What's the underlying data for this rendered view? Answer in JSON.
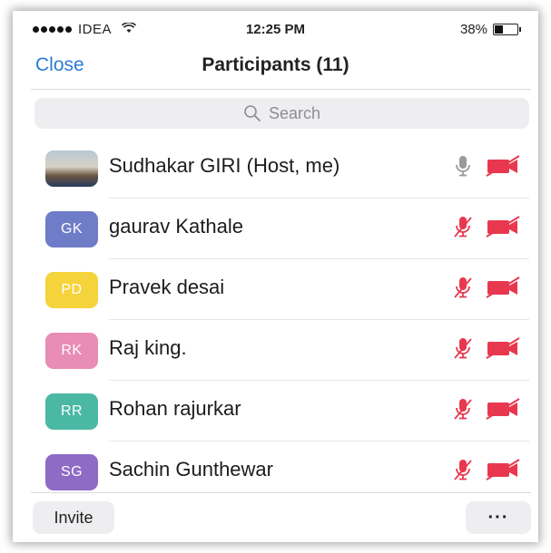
{
  "status_bar": {
    "carrier": "IDEA",
    "time": "12:25 PM",
    "battery": "38%",
    "battery_level": 0.38
  },
  "nav": {
    "close_label": "Close",
    "title": "Participants (11)"
  },
  "search": {
    "placeholder": "Search"
  },
  "participants": [
    {
      "initials": "",
      "name": "Sudhakar GIRI (Host, me)",
      "avatar_color": "",
      "has_photo": true,
      "mic": "on",
      "video": "off"
    },
    {
      "initials": "GK",
      "name": "gaurav Kathale",
      "avatar_color": "#6f7cc8",
      "has_photo": false,
      "mic": "off",
      "video": "off"
    },
    {
      "initials": "PD",
      "name": "Pravek desai",
      "avatar_color": "#f5d33a",
      "has_photo": false,
      "mic": "off",
      "video": "off"
    },
    {
      "initials": "RK",
      "name": "Raj king.",
      "avatar_color": "#e98cb6",
      "has_photo": false,
      "mic": "off",
      "video": "off"
    },
    {
      "initials": "RR",
      "name": "Rohan rajurkar",
      "avatar_color": "#4bb8a4",
      "has_photo": false,
      "mic": "off",
      "video": "off"
    },
    {
      "initials": "SG",
      "name": "Sachin Gunthewar",
      "avatar_color": "#8e6cc6",
      "has_photo": false,
      "mic": "off",
      "video": "off"
    }
  ],
  "footer": {
    "invite_label": "Invite",
    "more_label": "···"
  },
  "colors": {
    "accent": "#2b7bd6",
    "muted_red": "#e8384f",
    "mic_on_gray": "#9a9a9a"
  }
}
